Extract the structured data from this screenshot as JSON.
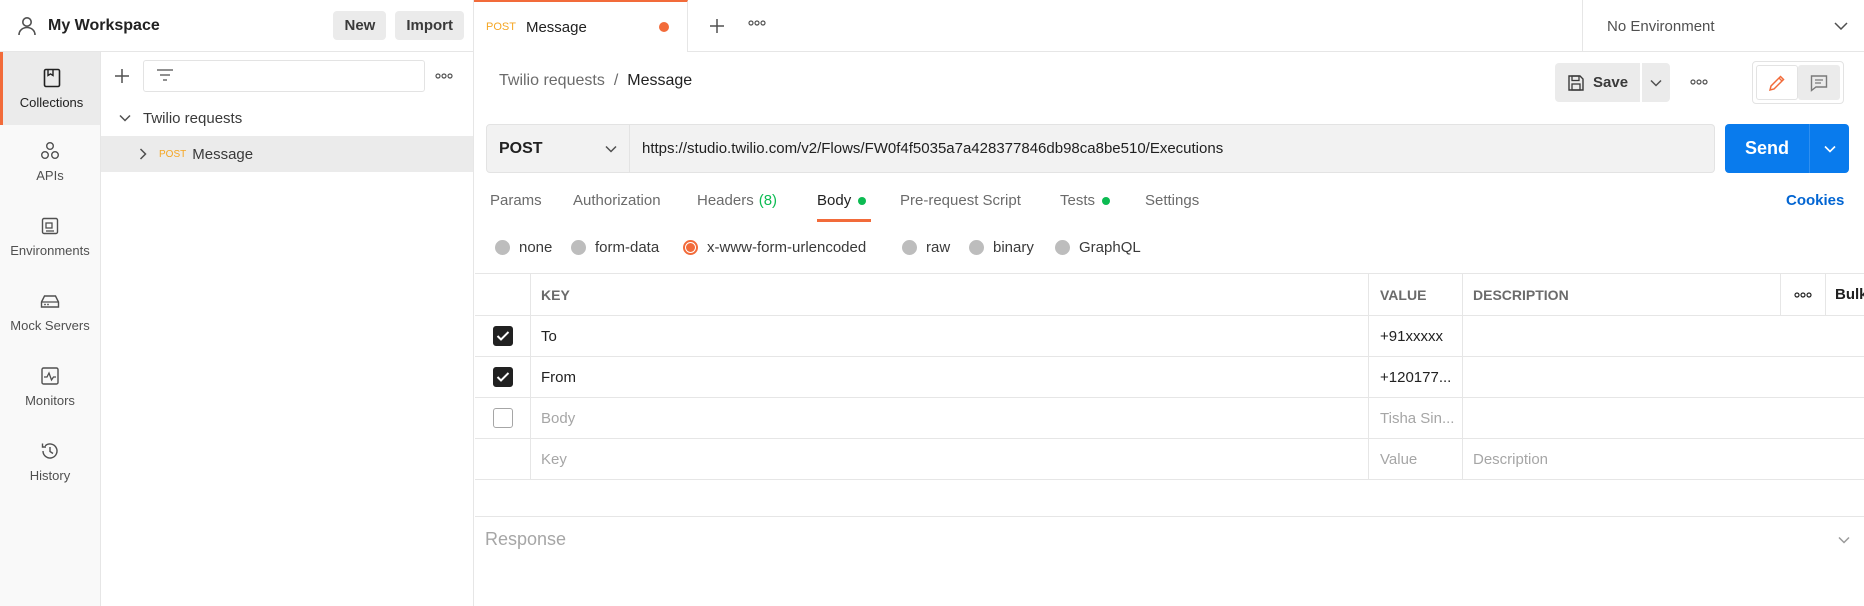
{
  "workspace": {
    "title": "My Workspace",
    "new_label": "New",
    "import_label": "Import"
  },
  "rail": {
    "items": [
      {
        "label": "Collections",
        "icon": "collections-icon",
        "active": true
      },
      {
        "label": "APIs",
        "icon": "apis-icon"
      },
      {
        "label": "Environments",
        "icon": "environments-icon"
      },
      {
        "label": "Mock Servers",
        "icon": "mock-servers-icon"
      },
      {
        "label": "Monitors",
        "icon": "monitors-icon"
      },
      {
        "label": "History",
        "icon": "history-icon"
      }
    ]
  },
  "collections": {
    "filter_placeholder": "",
    "folder": "Twilio requests",
    "request": {
      "method": "POST",
      "name": "Message"
    }
  },
  "tabs": {
    "active": {
      "method": "POST",
      "title": "Message",
      "unsaved": true
    }
  },
  "environment": {
    "selected": "No Environment"
  },
  "request": {
    "breadcrumb_parent": "Twilio requests",
    "breadcrumb_sep": "/",
    "breadcrumb_current": "Message",
    "save_label": "Save",
    "method": "POST",
    "url": "https://studio.twilio.com/v2/Flows/FW0f4f5035a7a428377846db98ca8be510/Executions",
    "send_label": "Send"
  },
  "req_tabs": {
    "params": "Params",
    "authorization": "Authorization",
    "headers": "Headers",
    "headers_count": "(8)",
    "body": "Body",
    "prerequest": "Pre-request Script",
    "tests": "Tests",
    "settings": "Settings",
    "cookies": "Cookies"
  },
  "body_types": {
    "none": "none",
    "form_data": "form-data",
    "urlencoded": "x-www-form-urlencoded",
    "raw": "raw",
    "binary": "binary",
    "graphql": "GraphQL",
    "selected": "x-www-form-urlencoded"
  },
  "params_table": {
    "headers": {
      "key": "KEY",
      "value": "VALUE",
      "description": "DESCRIPTION",
      "bulk_edit": "Bulk Edit"
    },
    "rows": [
      {
        "checked": true,
        "key": "To",
        "value": "+91xxxxx",
        "description": ""
      },
      {
        "checked": true,
        "key": "From",
        "value": "+120177...",
        "description": ""
      },
      {
        "checked": false,
        "key": "Body",
        "value": "Tisha Sin...",
        "description": ""
      }
    ],
    "placeholder": {
      "key": "Key",
      "value": "Value",
      "description": "Description"
    }
  },
  "response": {
    "label": "Response"
  },
  "colors": {
    "accent": "#f26b3a",
    "send": "#097bed",
    "green": "#0cbb52",
    "method_post": "#f5a623",
    "link": "#0265d2"
  }
}
